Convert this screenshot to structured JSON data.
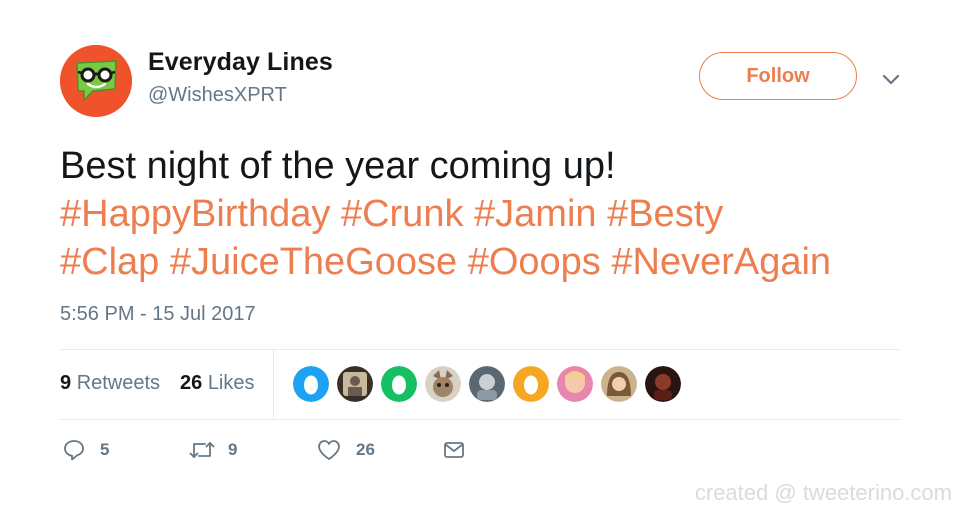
{
  "account": {
    "name": "Everyday Lines",
    "handle": "@WishesXPRT",
    "follow_label": "Follow"
  },
  "tweet": {
    "text_plain": "Best night of the year coming up!",
    "hashtags_line1": [
      "#HappyBirthday",
      "#Crunk",
      "#Jamin",
      "#Besty"
    ],
    "hashtags_line2": [
      "#Clap",
      "#JuiceTheGoose",
      "#Ooops",
      "#NeverAgain"
    ],
    "timestamp": "5:56 PM - 15 Jul 2017"
  },
  "stats": {
    "retweets_count": "9",
    "retweets_label": "Retweets",
    "likes_count": "26",
    "likes_label": "Likes"
  },
  "liker_avatars": [
    {
      "kind": "egg",
      "bg": "#1da1f2"
    },
    {
      "kind": "photo",
      "bg": "#6b5a4e"
    },
    {
      "kind": "egg",
      "bg": "#17bf63"
    },
    {
      "kind": "photo",
      "bg": "#8b7d6b"
    },
    {
      "kind": "photo",
      "bg": "#7d8a93"
    },
    {
      "kind": "egg",
      "bg": "#f5a623"
    },
    {
      "kind": "photo",
      "bg": "#f3a4c0"
    },
    {
      "kind": "photo",
      "bg": "#a58a62"
    },
    {
      "kind": "photo",
      "bg": "#3b1f1a"
    }
  ],
  "actions": {
    "reply_count": "5",
    "retweet_count": "9",
    "like_count": "26"
  },
  "watermark": "created @ tweeterino.com",
  "colors": {
    "accent": "#ec7e4f",
    "text": "#14171a",
    "secondary": "#657786",
    "divider": "#e6ecf0"
  }
}
